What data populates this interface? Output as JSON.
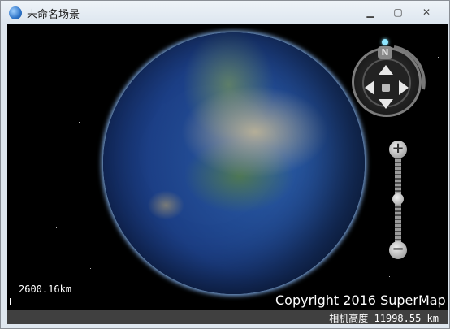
{
  "window": {
    "title": "未命名场景",
    "controls": {
      "minimize": "▁",
      "maximize": "▢",
      "close": "✕"
    }
  },
  "navigation": {
    "north_label": "N"
  },
  "zoom": {
    "plus": "+",
    "minus": "−"
  },
  "scale": {
    "label": "2600.16km"
  },
  "copyright": "Copyright 2016 SuperMap",
  "status": {
    "camera_height": "相机高度 11998.55 km"
  },
  "icons": {
    "app": "globe-icon",
    "north": "compass-north-icon",
    "pan": "pan-arrows-icon"
  }
}
